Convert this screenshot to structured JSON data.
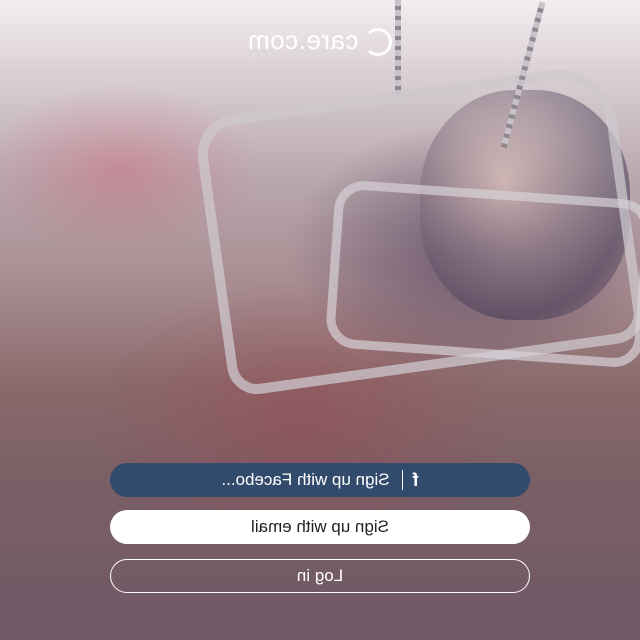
{
  "brand": {
    "logo_text": "care.com"
  },
  "buttons": {
    "facebook": {
      "icon": "f",
      "label": "Sign up with Facebo..."
    },
    "email": {
      "label": "Sign up with email"
    },
    "login": {
      "label": "Log in"
    }
  },
  "colors": {
    "facebook_button": "#324a6c",
    "email_button": "#ffffff",
    "outline": "#ffffff"
  }
}
